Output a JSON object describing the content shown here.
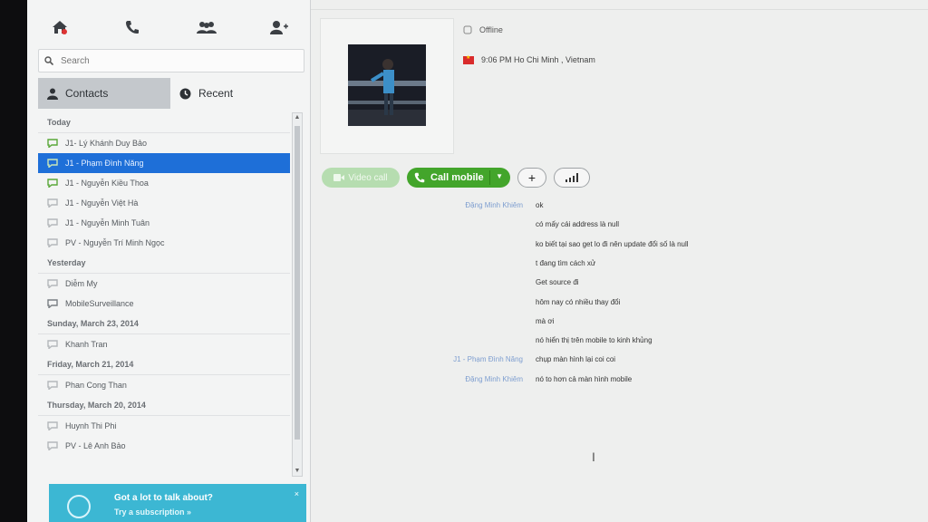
{
  "left_panel": {
    "nav": [
      {
        "name": "home",
        "icon": "home-icon"
      },
      {
        "name": "call",
        "icon": "phone-icon"
      },
      {
        "name": "contacts",
        "icon": "group-icon"
      },
      {
        "name": "add-contact",
        "icon": "add-person-icon"
      }
    ],
    "search_placeholder": "Search",
    "tabs": {
      "contacts": "Contacts",
      "recent": "Recent"
    },
    "groups": [
      {
        "header": "Today",
        "items": [
          {
            "label": "J1- Lý Khánh Duy Bảo",
            "selected": false,
            "status": "green"
          },
          {
            "label": "J1 - Phạm Đình Năng",
            "selected": true,
            "status": "green"
          },
          {
            "label": "J1 - Nguyễn Kiều Thoa",
            "selected": false,
            "status": "green"
          },
          {
            "label": "J1 - Nguyễn Việt Hà",
            "selected": false,
            "status": "gray"
          },
          {
            "label": "J1 - Nguyễn Minh Tuân",
            "selected": false,
            "status": "gray"
          },
          {
            "label": "PV - Nguyễn Trí Minh Ngọc",
            "selected": false,
            "status": "gray"
          }
        ]
      },
      {
        "header": "Yesterday",
        "items": [
          {
            "label": "Diễm My",
            "selected": false,
            "status": "gray"
          },
          {
            "label": "MobileSurveillance",
            "selected": false,
            "status": "group"
          }
        ]
      },
      {
        "header": "Sunday, March 23, 2014",
        "items": [
          {
            "label": "Khanh Tran",
            "selected": false,
            "status": "gray"
          }
        ]
      },
      {
        "header": "Friday, March 21, 2014",
        "items": [
          {
            "label": "Phan Cong Than",
            "selected": false,
            "status": "gray"
          }
        ]
      },
      {
        "header": "Thursday, March 20, 2014",
        "items": [
          {
            "label": "Huynh Thi Phi",
            "selected": false,
            "status": "gray"
          },
          {
            "label": "PV - Lê Anh Bảo",
            "selected": false,
            "status": "gray"
          }
        ]
      }
    ],
    "promo": {
      "line1": "Got a lot to talk about?",
      "line2": "Try a subscription »",
      "close": "×"
    }
  },
  "right_panel": {
    "status": "Offline",
    "location": "9:06 PM Ho Chi Minh , Vietnam",
    "buttons": {
      "video_call": "Video call",
      "call_mobile": "Call mobile",
      "add": "+",
      "signal": "signal"
    },
    "messages": [
      {
        "sender": "Đặng Minh Khiêm",
        "text": "ok"
      },
      {
        "sender": "",
        "text": "có mấy cái address là null"
      },
      {
        "sender": "",
        "text": "ko biết tại sao get lo đi nên update đổi số là null"
      },
      {
        "sender": "",
        "text": "t đang tìm cách xử"
      },
      {
        "sender": "",
        "text": "Get source đi"
      },
      {
        "sender": "",
        "text": "hôm nay có nhiều thay đổi"
      },
      {
        "sender": "",
        "text": "mà ơi"
      },
      {
        "sender": "",
        "text": "nó hiển thị trên mobile to kinh khủng"
      },
      {
        "sender": "J1 - Phạm Đình Năng",
        "text": "chụp màn hình lại coi coi"
      },
      {
        "sender": "Đặng Minh Khiêm",
        "text": "nó to hơn cả màn hình mobile"
      }
    ]
  },
  "colors": {
    "selected": "#1e6fd8",
    "call_green": "#43a52b",
    "promo": "#3cb7d3",
    "sender_blue": "#7e9ed0"
  }
}
